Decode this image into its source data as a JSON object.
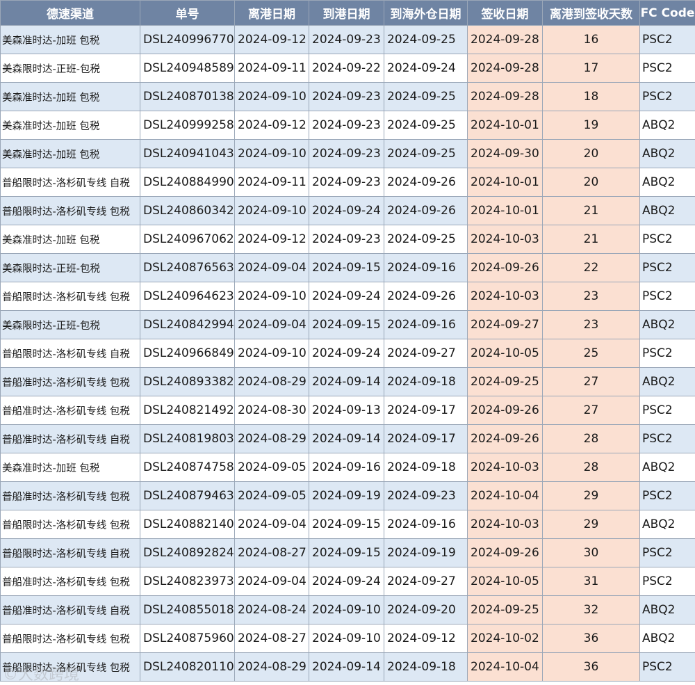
{
  "headers": [
    "德速渠道",
    "单号",
    "离港日期",
    "到港日期",
    "到海外仓日期",
    "签收日期",
    "离港到签收天数",
    "FC Code"
  ],
  "rows": [
    [
      "美森准时达-加班 包税",
      "DSL240996770",
      "2024-09-12",
      "2024-09-23",
      "2024-09-25",
      "2024-09-28",
      "16",
      "PSC2"
    ],
    [
      "美森限时达-正班-包税",
      "DSL240948589",
      "2024-09-11",
      "2024-09-22",
      "2024-09-24",
      "2024-09-28",
      "17",
      "PSC2"
    ],
    [
      "美森准时达-加班 包税",
      "DSL240870138",
      "2024-09-10",
      "2024-09-23",
      "2024-09-25",
      "2024-09-28",
      "18",
      "PSC2"
    ],
    [
      "美森准时达-加班 包税",
      "DSL240999258",
      "2024-09-12",
      "2024-09-23",
      "2024-09-25",
      "2024-10-01",
      "19",
      "ABQ2"
    ],
    [
      "美森准时达-加班 包税",
      "DSL240941043",
      "2024-09-10",
      "2024-09-23",
      "2024-09-25",
      "2024-09-30",
      "20",
      "ABQ2"
    ],
    [
      "普船限时达-洛杉矶专线 自税",
      "DSL240884990",
      "2024-09-11",
      "2024-09-23",
      "2024-09-26",
      "2024-10-01",
      "20",
      "ABQ2"
    ],
    [
      "普船限时达-洛杉矶专线 包税",
      "DSL240860342",
      "2024-09-10",
      "2024-09-24",
      "2024-09-26",
      "2024-10-01",
      "21",
      "ABQ2"
    ],
    [
      "美森准时达-加班 包税",
      "DSL240967062",
      "2024-09-12",
      "2024-09-23",
      "2024-09-25",
      "2024-10-03",
      "21",
      "PSC2"
    ],
    [
      "美森限时达-正班-包税",
      "DSL240876563",
      "2024-09-04",
      "2024-09-15",
      "2024-09-16",
      "2024-09-26",
      "22",
      "PSC2"
    ],
    [
      "普船限时达-洛杉矶专线 包税",
      "DSL240964623",
      "2024-09-10",
      "2024-09-24",
      "2024-09-26",
      "2024-10-03",
      "23",
      "PSC2"
    ],
    [
      "美森限时达-正班-包税",
      "DSL240842994",
      "2024-09-04",
      "2024-09-15",
      "2024-09-16",
      "2024-09-27",
      "23",
      "ABQ2"
    ],
    [
      "普船限时达-洛杉矶专线 自税",
      "DSL240966849",
      "2024-09-10",
      "2024-09-24",
      "2024-09-27",
      "2024-10-05",
      "25",
      "PSC2"
    ],
    [
      "普船准时达-洛杉矶专线 包税",
      "DSL240893382",
      "2024-08-29",
      "2024-09-14",
      "2024-09-18",
      "2024-09-25",
      "27",
      "ABQ2"
    ],
    [
      "普船准时达-洛杉矶专线 包税",
      "DSL240821492",
      "2024-08-30",
      "2024-09-13",
      "2024-09-17",
      "2024-09-26",
      "27",
      "PSC2"
    ],
    [
      "普船准时达-洛杉矶专线 自税",
      "DSL240819803",
      "2024-08-29",
      "2024-09-14",
      "2024-09-17",
      "2024-09-26",
      "28",
      "PSC2"
    ],
    [
      "美森准时达-加班 包税",
      "DSL240874758",
      "2024-09-05",
      "2024-09-16",
      "2024-09-18",
      "2024-10-03",
      "28",
      "ABQ2"
    ],
    [
      "普船准时达-洛杉矶专线 包税",
      "DSL240879463",
      "2024-09-05",
      "2024-09-19",
      "2024-09-23",
      "2024-10-04",
      "29",
      "PSC2"
    ],
    [
      "普船限时达-洛杉矶专线 包税",
      "DSL240882140",
      "2024-09-04",
      "2024-09-15",
      "2024-09-16",
      "2024-10-03",
      "29",
      "ABQ2"
    ],
    [
      "普船限时达-洛杉矶专线 自税",
      "DSL240892824",
      "2024-08-27",
      "2024-09-15",
      "2024-09-19",
      "2024-09-26",
      "30",
      "PSC2"
    ],
    [
      "普船准时达-洛杉矶专线 包税",
      "DSL240823973",
      "2024-09-04",
      "2024-09-24",
      "2024-09-27",
      "2024-10-05",
      "31",
      "PSC2"
    ],
    [
      "普船准时达-洛杉矶专线 自税",
      "DSL240855018",
      "2024-08-24",
      "2024-09-10",
      "2024-09-20",
      "2024-09-25",
      "32",
      "ABQ2"
    ],
    [
      "普船限时达-洛杉矶专线 包税",
      "DSL240875960",
      "2024-08-27",
      "2024-09-10",
      "2024-09-12",
      "2024-10-02",
      "36",
      "ABQ2"
    ],
    [
      "普船限时达-洛杉矶专线 包税",
      "DSL240820110",
      "2024-08-29",
      "2024-09-14",
      "2024-09-18",
      "2024-10-04",
      "36",
      "PSC2"
    ]
  ],
  "watermark": "©大数跨境"
}
